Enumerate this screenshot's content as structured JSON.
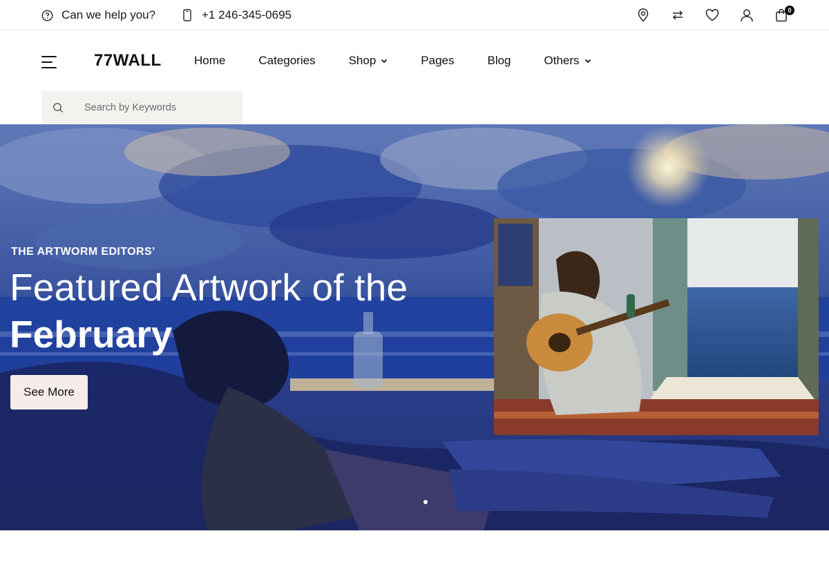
{
  "topbar": {
    "help_text": "Can we help you?",
    "phone": "+1 246-345-0695",
    "icons": [
      "map-pin-icon",
      "compare-arrows-icon",
      "heart-icon",
      "user-icon",
      "shopping-bag-icon"
    ],
    "cart_count": "0"
  },
  "header": {
    "logo": "77WALL",
    "nav": [
      {
        "label": "Home",
        "dropdown": false
      },
      {
        "label": "Categories",
        "dropdown": false
      },
      {
        "label": "Shop",
        "dropdown": true
      },
      {
        "label": "Pages",
        "dropdown": false
      },
      {
        "label": "Blog",
        "dropdown": false
      },
      {
        "label": "Others",
        "dropdown": true
      }
    ]
  },
  "search": {
    "placeholder": "Search by Keywords",
    "value": ""
  },
  "hero": {
    "eyebrow": "THE ARTWORM EDITORS’",
    "headline_line1": "Featured Artwork of the",
    "headline_line2": "February",
    "cta_label": "See More",
    "slides_count": 1,
    "active_slide": 1
  },
  "colors": {
    "hero_blue": "#2b3d8c",
    "cta_bg": "#f6ecec",
    "search_bg": "#f3f2ef",
    "text_dark": "#111111"
  }
}
